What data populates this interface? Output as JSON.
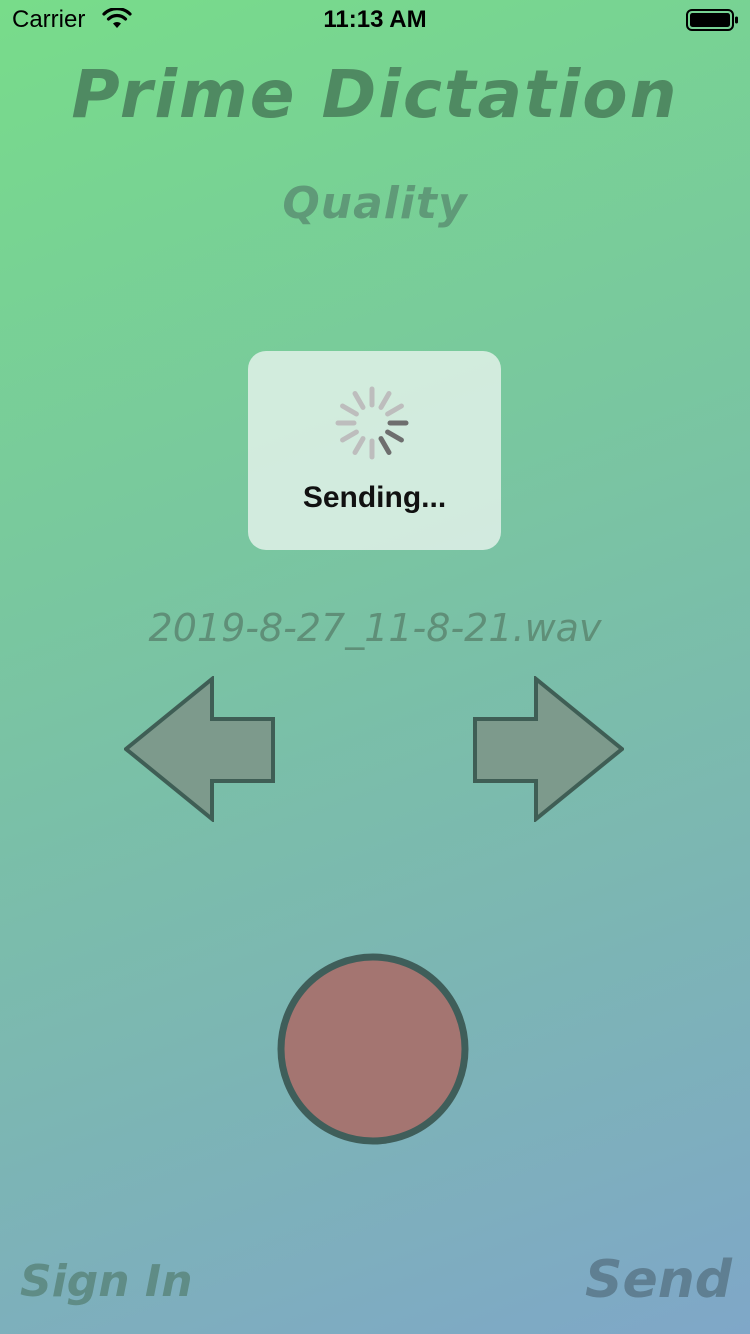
{
  "status_bar": {
    "carrier": "Carrier",
    "time": "11:13 AM",
    "icons": [
      "wifi-icon",
      "battery-icon"
    ]
  },
  "app": {
    "title": "Prime Dictation",
    "quality_label": "Quality",
    "filename": "2019-8-27_11-8-21.wav",
    "sign_in_label": "Sign In",
    "send_label": "Send"
  },
  "hud": {
    "label": "Sending...",
    "icon": "spinner-icon"
  },
  "controls": {
    "previous_icon": "arrow-left-icon",
    "next_icon": "arrow-right-icon",
    "record_icon": "record-icon"
  },
  "colors": {
    "gradient_start": "#78dc8a",
    "gradient_end": "#7fa7c8",
    "arrow_fill": "#7d9a8c",
    "arrow_stroke": "#3f5e55",
    "record_fill": "#a47571",
    "record_stroke": "#3f5e5a",
    "hud_background": "#e8f4ee"
  }
}
